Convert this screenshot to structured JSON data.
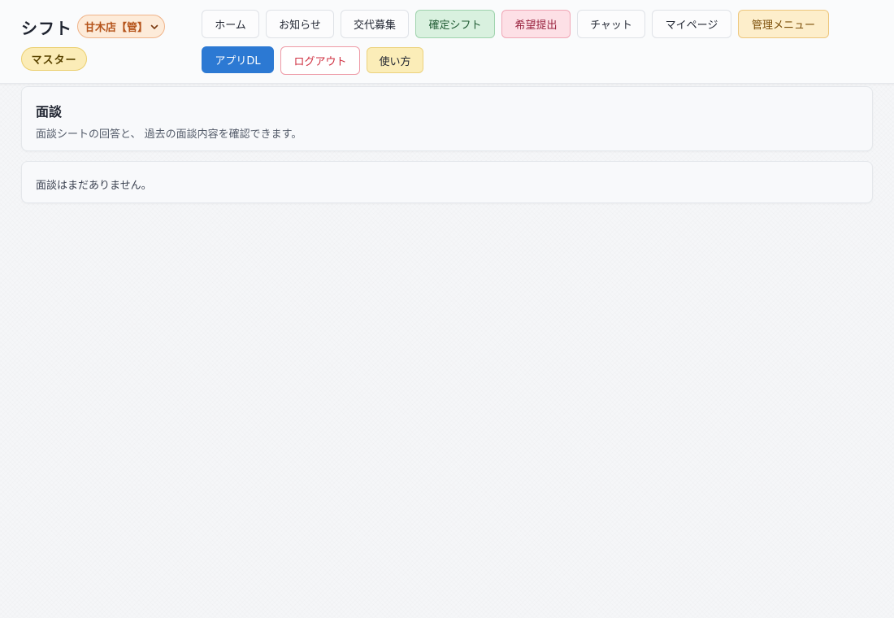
{
  "header": {
    "app_title": "シフト",
    "store_select": {
      "value": "甘木店【管】"
    },
    "role_badge": "マスター",
    "nav": {
      "home": "ホーム",
      "notices": "お知らせ",
      "swap": "交代募集",
      "confirmed": "確定シフト",
      "request": "希望提出",
      "chat": "チャット",
      "mypage": "マイページ",
      "admin": "管理メニュー",
      "app_dl": "アプリDL",
      "logout": "ログアウト",
      "howto": "使い方"
    }
  },
  "main": {
    "section_title": "面談",
    "section_desc": "面談シートの回答と、 過去の面談内容を確認できます。",
    "empty_message": "面談はまだありません。"
  },
  "colors": {
    "confirmed_bg": "#d9f1df",
    "request_bg": "#fde0e6",
    "admin_bg": "#fdeecb",
    "app_dl_bg": "#2c79d3",
    "logout_text": "#cf2e3f"
  }
}
